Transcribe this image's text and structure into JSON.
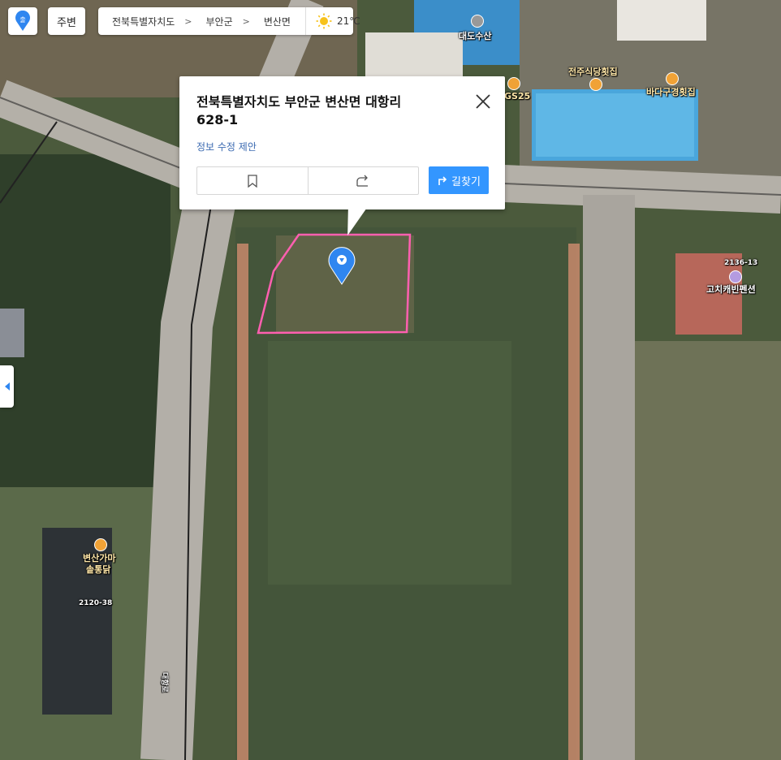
{
  "toolbar": {
    "logo_label": "출",
    "nearby_label": "주변",
    "breadcrumb": [
      "전북특별자치도",
      "부안군",
      "변산면"
    ],
    "weather_temp": "21℃",
    "weather_icon": "sun-icon"
  },
  "popup": {
    "address_line1": "전북특별자치도 부안군 변산면 대항리",
    "address_line2": "628-1",
    "edit_link": "정보 수정 제안",
    "bookmark_icon": "bookmark-icon",
    "share_icon": "share-icon",
    "route_label": "길찾기"
  },
  "map_labels": {
    "daedo": "대도수산",
    "jeonju": "전주식당횟집",
    "bada": "바다구경횟집",
    "gs25": "GS25",
    "gochi": "고치캐빈펜션",
    "lot_2136": "2136-13",
    "byeonsan1": "변산가마",
    "byeonsan2": "솥통닭",
    "lot_2120": "2120-38",
    "road": "대항로"
  },
  "colors": {
    "accent": "#3396ff",
    "parcel_outline": "#ff5fb0",
    "marker": "#2f86f0"
  }
}
